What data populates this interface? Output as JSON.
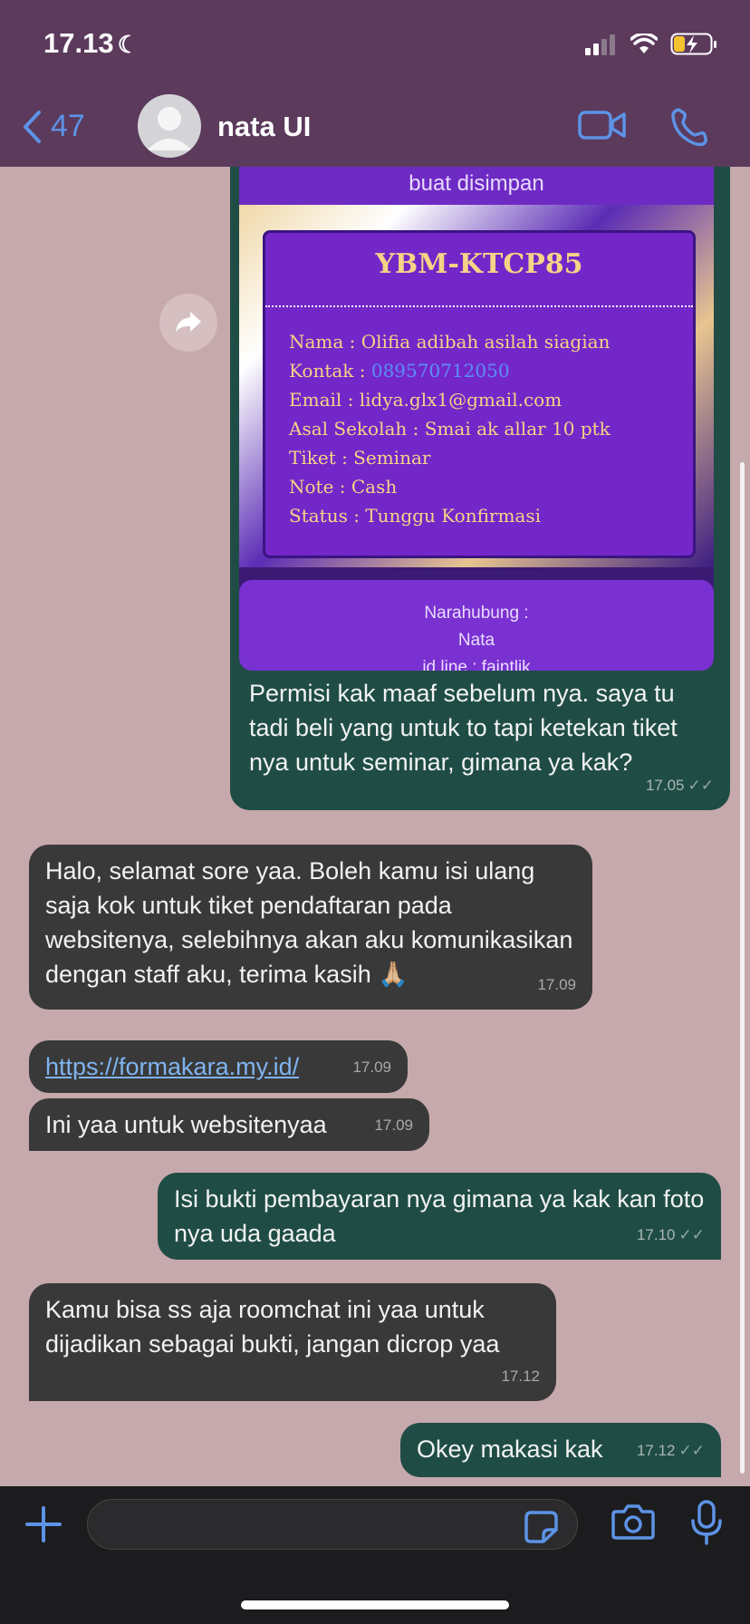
{
  "status": {
    "time": "17.13"
  },
  "header": {
    "back_count": "47",
    "contact_name": "nata UI"
  },
  "image": {
    "top_text": "buat disimpan",
    "ticket_code": "YBM-KTCP85",
    "lines": {
      "nama": "Nama : Olifia adibah asilah siagian",
      "kontak_label": "Kontak : ",
      "kontak_value": "089570712050",
      "email": "Email : lidya.glx1@gmail.com",
      "sekolah": "Asal Sekolah : Smai ak allar 10 ptk",
      "tiket": "Tiket : Seminar",
      "note": "Note : Cash",
      "status": "Status : Tunggu Konfirmasi"
    },
    "bottom_line1": "Narahubung :",
    "bottom_line2": "Nata",
    "bottom_line3": "id line : faintlik"
  },
  "messages": [
    {
      "text": "Permisi kak maaf sebelum nya. saya tu tadi beli yang untuk to tapi ketekan tiket nya untuk seminar, gimana ya kak?",
      "time": "17.05"
    },
    {
      "text": "Halo, selamat sore yaa. Boleh kamu isi ulang saja kok untuk tiket pendaftaran pada websitenya, selebihnya akan aku komunikasikan dengan staff aku, terima kasih 🙏🏼",
      "time": "17.09"
    },
    {
      "text": "https://formakara.my.id/",
      "time": "17.09"
    },
    {
      "text": "Ini yaa untuk websitenyaa",
      "time": "17.09"
    },
    {
      "text": "Isi bukti pembayaran nya gimana ya kak kan foto nya uda gaada",
      "time": "17.10"
    },
    {
      "text": "Kamu bisa ss aja roomchat ini yaa untuk dijadikan sebagai bukti, jangan dicrop yaa",
      "time": "17.12"
    },
    {
      "text": "Okey makasi kak",
      "time": "17.12"
    }
  ],
  "input": {
    "placeholder": ""
  },
  "colors": {
    "header": "#5b3a5c",
    "chat_bg": "#c6a9ac",
    "outgoing": "#1f4d45",
    "incoming": "#393939",
    "accent": "#5d93e6"
  }
}
